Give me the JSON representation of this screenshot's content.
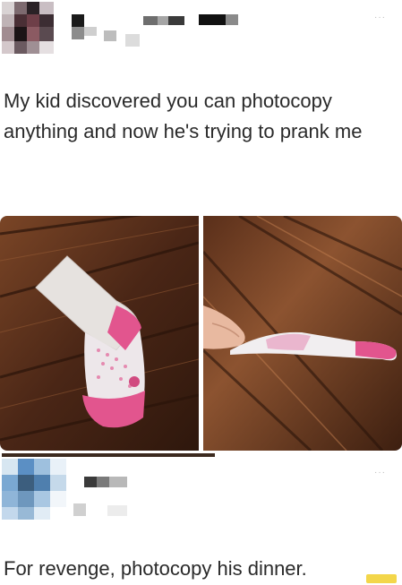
{
  "post1": {
    "text": "My kid discovered you can photocopy anything and now he's trying to prank me",
    "more_label": "···"
  },
  "photos": {
    "left_alt": "",
    "right_alt": ""
  },
  "post2": {
    "text": "For revenge, photocopy his dinner.",
    "more_label": "···"
  },
  "colors": {
    "wood_dark": "#3a1f12",
    "wood_mid": "#6b3a20",
    "wood_light": "#8c5530",
    "sock_white": "#e6e2df",
    "sock_pink": "#e2558e",
    "avatar_blue": "#5b8fc4"
  }
}
